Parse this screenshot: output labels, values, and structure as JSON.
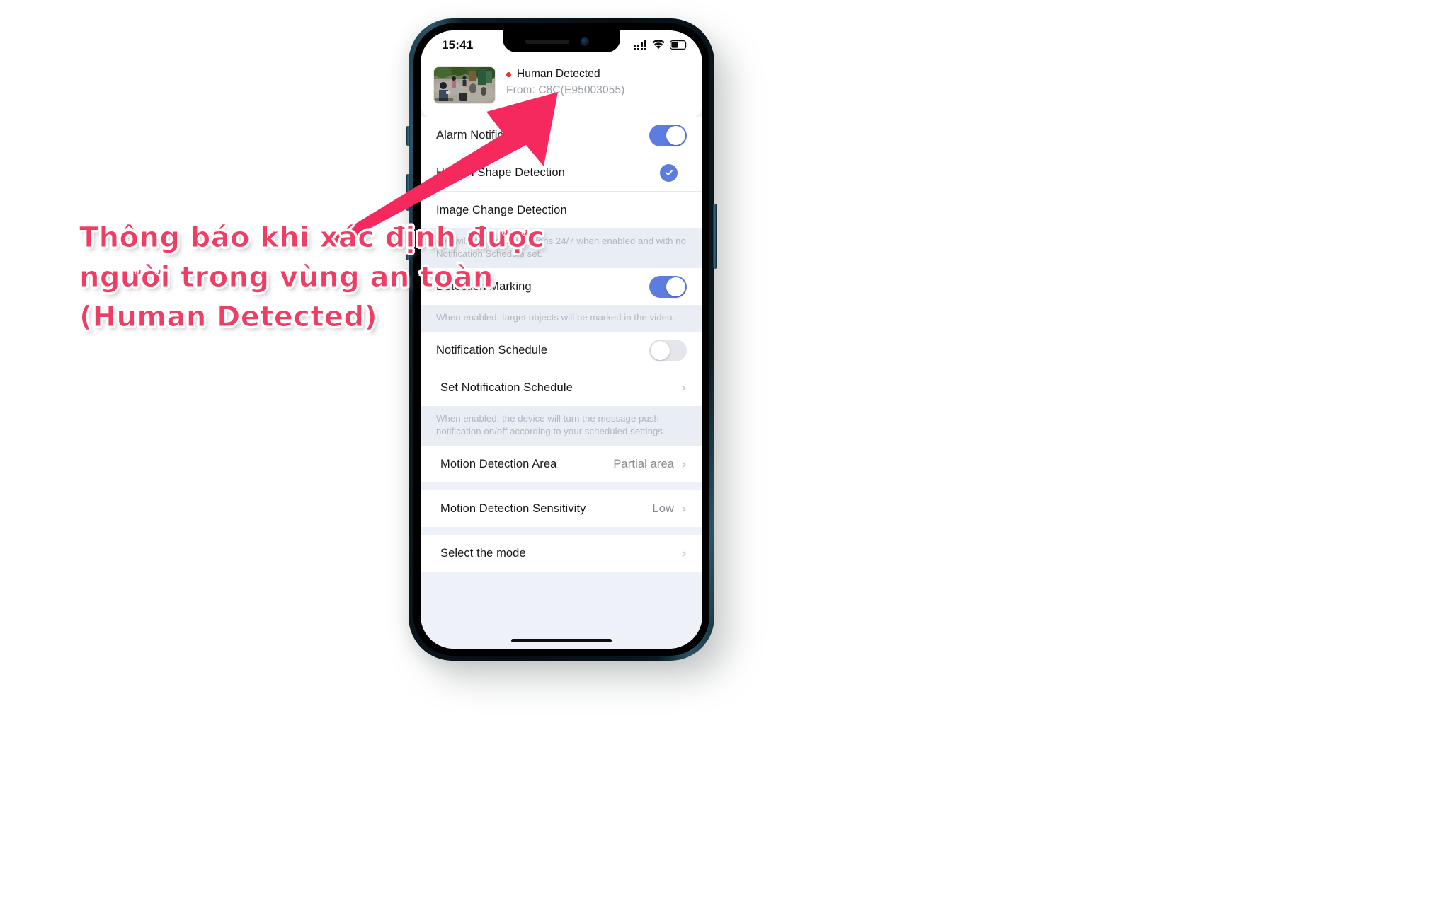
{
  "annotation": {
    "lines": [
      "Thông báo khi xác định được",
      "người trong vùng an toàn",
      "(Human Detected)"
    ],
    "color": "#ef3d63",
    "arrow_color": "#f5295e"
  },
  "phone": {
    "frame_color": "#11232c",
    "status_bar": {
      "time": "15:41",
      "signal_icon": "cellular-signal-icon",
      "wifi_icon": "wifi-icon",
      "battery_icon": "battery-icon",
      "battery_level_pct": 45
    },
    "home_indicator": "home-indicator"
  },
  "notification": {
    "thumbnail_name": "camera-snapshot-thumbnail",
    "status_dot_color": "#ef2f2f",
    "title": "Human Detected",
    "subtitle": "From: C8C(E95003055)"
  },
  "settings": {
    "accent_color": "#5c7ce0",
    "groups": [
      {
        "rows": [
          {
            "id": "alarm-notification",
            "label": "Alarm Notification",
            "control": "toggle",
            "state": "on"
          },
          {
            "id": "human-shape-detection",
            "label": "Human Shape Detection",
            "control": "check",
            "state": "on"
          },
          {
            "id": "image-change-detection",
            "label": "Image Change Detection",
            "control": "none",
            "state": "off"
          }
        ],
        "note": "You will receive notifications 24/7 when enabled and with no Notification Schedule set."
      },
      {
        "rows": [
          {
            "id": "detection-marking",
            "label": "Detection Marking",
            "control": "toggle",
            "state": "on"
          }
        ],
        "note": "When enabled, target objects will be marked in the video."
      },
      {
        "rows": [
          {
            "id": "notification-schedule",
            "label": "Notification Schedule",
            "control": "toggle",
            "state": "off"
          },
          {
            "id": "set-notification-schedule",
            "label": "Set Notification Schedule",
            "control": "chevron",
            "indent": true
          }
        ],
        "note": "When enabled, the device will turn the message push notification on/off according to your scheduled settings."
      },
      {
        "rows": [
          {
            "id": "motion-detection-area",
            "label": "Motion Detection Area",
            "control": "chevron",
            "value": "Partial area"
          }
        ]
      },
      {
        "rows": [
          {
            "id": "motion-detection-sensitivity",
            "label": "Motion Detection Sensitivity",
            "control": "chevron",
            "value": "Low"
          }
        ]
      },
      {
        "rows": [
          {
            "id": "select-the-mode",
            "label": "Select the mode",
            "control": "chevron"
          }
        ]
      }
    ]
  }
}
